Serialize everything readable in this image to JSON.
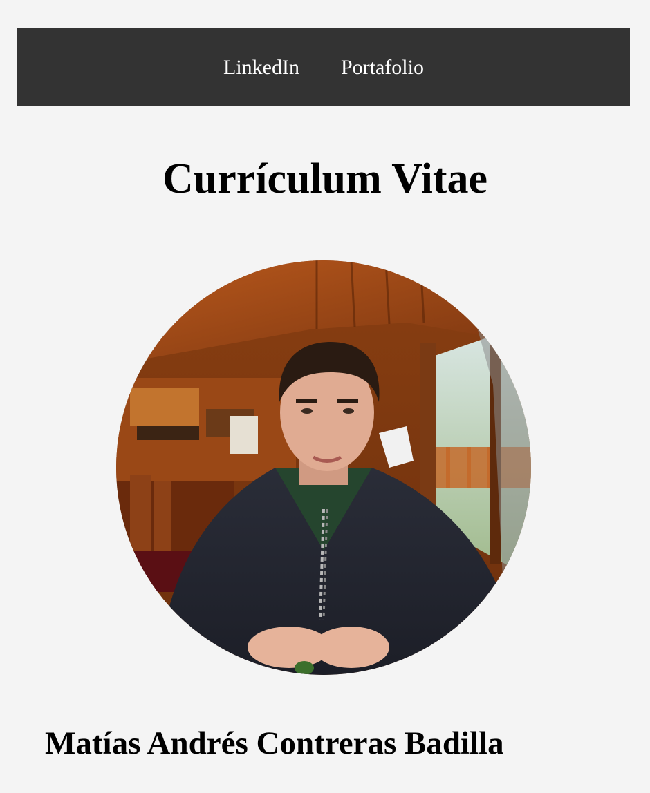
{
  "nav": {
    "links": [
      {
        "label": "LinkedIn"
      },
      {
        "label": "Portafolio"
      }
    ]
  },
  "page": {
    "title": "Currículum Vitae"
  },
  "profile": {
    "name": "Matías Andrés Contreras Badilla",
    "photo_alt": "profile-photo"
  },
  "colors": {
    "background": "#f4f4f4",
    "nav_background": "#333333",
    "nav_text": "#ffffff",
    "text": "#000000"
  }
}
